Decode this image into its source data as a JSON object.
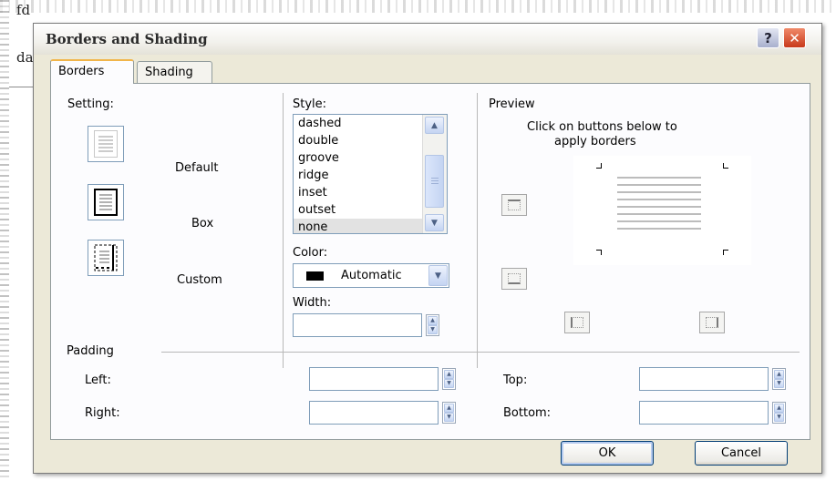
{
  "background_doc": {
    "line1": "fd",
    "line2": "da"
  },
  "dialog": {
    "title": "Borders and Shading",
    "help_label": "?",
    "close_label": "✕"
  },
  "tabs": [
    {
      "label": "Borders",
      "selected": true
    },
    {
      "label": "Shading",
      "selected": false
    }
  ],
  "setting": {
    "heading": "Setting:",
    "options": [
      {
        "label": "Default",
        "icon": "setting-default-icon"
      },
      {
        "label": "Box",
        "icon": "setting-box-icon"
      },
      {
        "label": "Custom",
        "icon": "setting-custom-icon"
      }
    ]
  },
  "style": {
    "heading": "Style:",
    "items": [
      "dashed",
      "double",
      "groove",
      "ridge",
      "inset",
      "outset",
      "none"
    ],
    "selected": "none"
  },
  "color": {
    "label": "Color:",
    "value": "Automatic",
    "swatch": "#000000"
  },
  "width": {
    "label": "Width:",
    "value": ""
  },
  "preview": {
    "heading": "Preview",
    "instruction_line1": "Click on buttons below to",
    "instruction_line2": "apply borders"
  },
  "padding": {
    "heading": "Padding",
    "left_label": "Left:",
    "right_label": "Right:",
    "top_label": "Top:",
    "bottom_label": "Bottom:",
    "left_value": "",
    "right_value": "",
    "top_value": "",
    "bottom_value": ""
  },
  "buttons": {
    "ok": "OK",
    "cancel": "Cancel"
  },
  "colors": {
    "dialog_bg": "#ece9d8",
    "panel_bg": "#fcfcfe",
    "close_red": "#c8391b",
    "tab_accent": "#f1b54a"
  }
}
